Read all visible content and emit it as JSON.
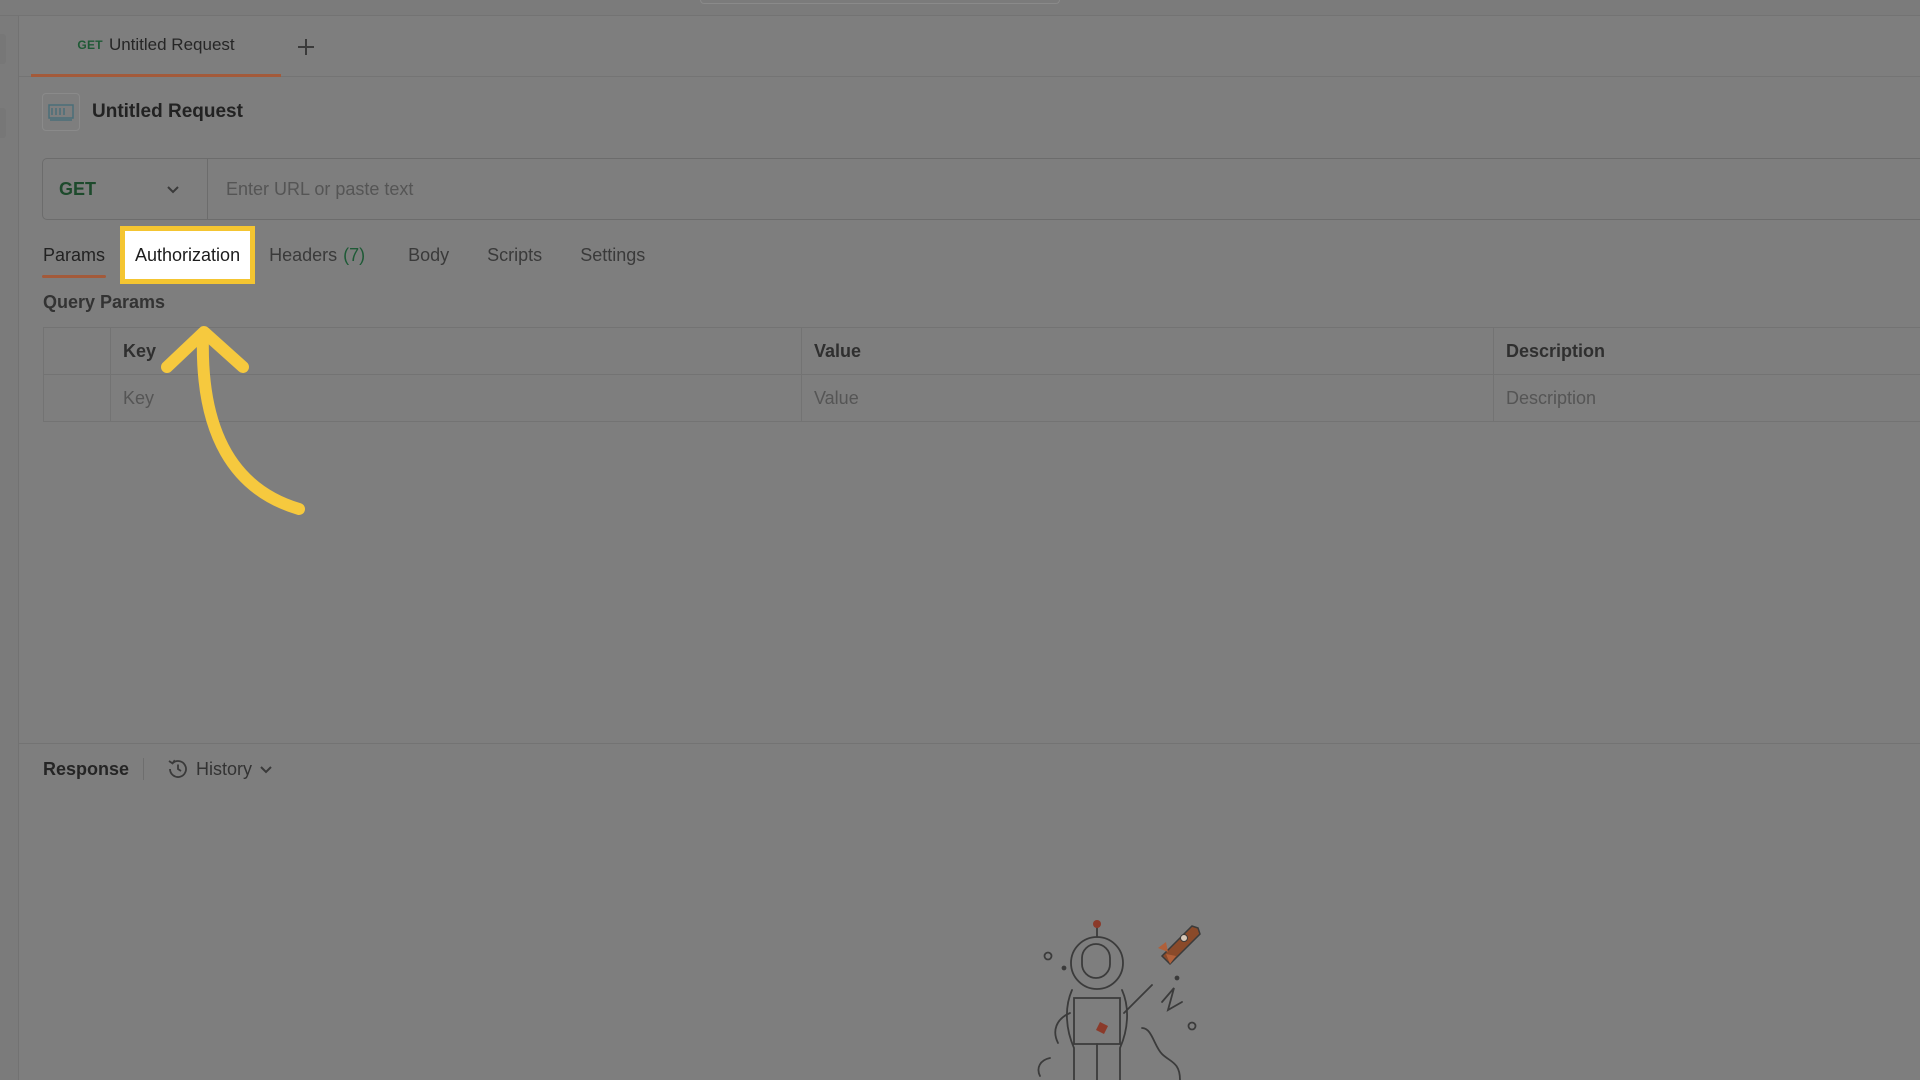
{
  "tabs": [
    {
      "method": "GET",
      "title": "Untitled Request"
    }
  ],
  "request": {
    "title": "Untitled Request",
    "method": "GET",
    "url_placeholder": "Enter URL or paste text"
  },
  "request_tabs": {
    "params": "Params",
    "authorization": "Authorization",
    "headers": "Headers",
    "headers_count": "(7)",
    "body": "Body",
    "scripts": "Scripts",
    "settings": "Settings"
  },
  "query_params": {
    "label": "Query Params",
    "columns": [
      "Key",
      "Value",
      "Description"
    ],
    "placeholders": [
      "Key",
      "Value",
      "Description"
    ]
  },
  "response": {
    "label": "Response",
    "history_label": "History"
  },
  "colors": {
    "highlight": "#f4c531",
    "accent": "#a35a3a",
    "method_green": "#1d4a2c"
  },
  "icons": [
    "plus-icon",
    "http-icon",
    "chevron-down-icon",
    "history-icon",
    "arrow-annotation-icon",
    "astronaut-illustration"
  ]
}
